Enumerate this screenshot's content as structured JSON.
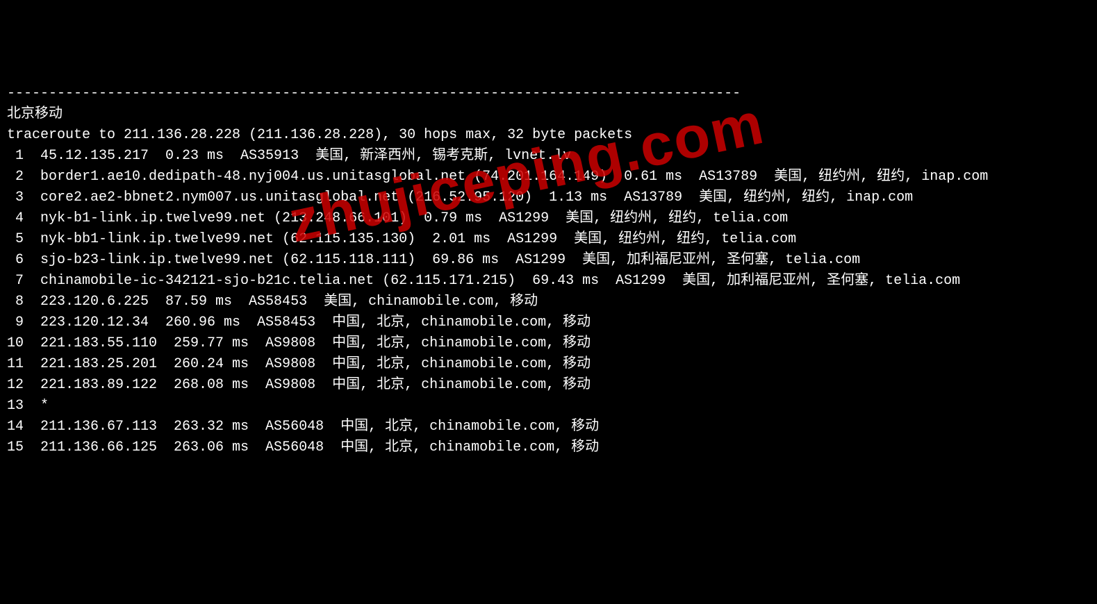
{
  "separator": "----------------------------------------------------------------------------------------",
  "header": "北京移动",
  "trace_header": "traceroute to 211.136.28.228 (211.136.28.228), 30 hops max, 32 byte packets",
  "watermark": "zhujiceping.com",
  "hops": [
    {
      "num": " 1",
      "line": "  45.12.135.217  0.23 ms  AS35913  美国, 新泽西州, 锡考克斯, lvnet.lv"
    },
    {
      "num": " 2",
      "line": "  border1.ae10.dedipath-48.nyj004.us.unitasglobal.net (74.201.164.149)  0.61 ms  AS13789  美国, 纽约州, 纽约, inap.com"
    },
    {
      "num": " 3",
      "line": "  core2.ae2-bbnet2.nym007.us.unitasglobal.net (216.52.95.120)  1.13 ms  AS13789  美国, 纽约州, 纽约, inap.com"
    },
    {
      "num": " 4",
      "line": "  nyk-b1-link.ip.twelve99.net (213.248.66.101)  0.79 ms  AS1299  美国, 纽约州, 纽约, telia.com"
    },
    {
      "num": " 5",
      "line": "  nyk-bb1-link.ip.twelve99.net (62.115.135.130)  2.01 ms  AS1299  美国, 纽约州, 纽约, telia.com"
    },
    {
      "num": " 6",
      "line": "  sjo-b23-link.ip.twelve99.net (62.115.118.111)  69.86 ms  AS1299  美国, 加利福尼亚州, 圣何塞, telia.com"
    },
    {
      "num": " 7",
      "line": "  chinamobile-ic-342121-sjo-b21c.telia.net (62.115.171.215)  69.43 ms  AS1299  美国, 加利福尼亚州, 圣何塞, telia.com"
    },
    {
      "num": " 8",
      "line": "  223.120.6.225  87.59 ms  AS58453  美国, chinamobile.com, 移动"
    },
    {
      "num": " 9",
      "line": "  223.120.12.34  260.96 ms  AS58453  中国, 北京, chinamobile.com, 移动"
    },
    {
      "num": "10",
      "line": "  221.183.55.110  259.77 ms  AS9808  中国, 北京, chinamobile.com, 移动"
    },
    {
      "num": "11",
      "line": "  221.183.25.201  260.24 ms  AS9808  中国, 北京, chinamobile.com, 移动"
    },
    {
      "num": "12",
      "line": "  221.183.89.122  268.08 ms  AS9808  中国, 北京, chinamobile.com, 移动"
    },
    {
      "num": "13",
      "line": "  *"
    },
    {
      "num": "14",
      "line": "  211.136.67.113  263.32 ms  AS56048  中国, 北京, chinamobile.com, 移动"
    },
    {
      "num": "15",
      "line": "  211.136.66.125  263.06 ms  AS56048  中国, 北京, chinamobile.com, 移动"
    }
  ]
}
